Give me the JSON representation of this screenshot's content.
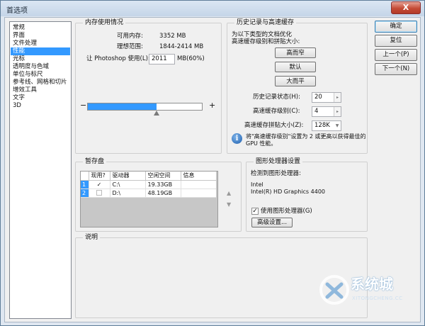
{
  "window": {
    "title": "首选项",
    "close_label": "X"
  },
  "categories": [
    {
      "label": "常规",
      "selected": false
    },
    {
      "label": "界面",
      "selected": false
    },
    {
      "label": "文件处理",
      "selected": false
    },
    {
      "label": "性能",
      "selected": true
    },
    {
      "label": "光标",
      "selected": false
    },
    {
      "label": "透明度与色域",
      "selected": false
    },
    {
      "label": "单位与标尺",
      "selected": false
    },
    {
      "label": "参考线、网格和切片",
      "selected": false
    },
    {
      "label": "增效工具",
      "selected": false
    },
    {
      "label": "文字",
      "selected": false
    },
    {
      "label": "3D",
      "selected": false
    }
  ],
  "memory": {
    "title": "内存使用情况",
    "available_label": "可用内存:",
    "available_value": "3352 MB",
    "ideal_label": "理想范围:",
    "ideal_value": "1844-2414 MB",
    "let_label": "让 Photoshop 使用(L):",
    "use_value": "2011",
    "unit_percent": "MB(60%)",
    "slider_minus": "−",
    "slider_plus": "+",
    "slider_fraction": 0.6,
    "fill_color": "#3399ff"
  },
  "history": {
    "title": "历史记录与高速缓存",
    "desc": "为以下类型的文档优化\n高速缓存级别和拼贴大小:",
    "btn_tall_thin": "高而窄",
    "btn_default": "默认",
    "btn_big_flat": "大而平",
    "states_label": "历史记录状态(H):",
    "states_value": "20",
    "cache_levels_label": "高速缓存级别(C):",
    "cache_levels_value": "4",
    "tile_size_label": "高速缓存拼贴大小(Z):",
    "tile_size_value": "128K",
    "info_text": "将\"高速缓存级别\"设置为 2 或更高以获得最佳的\nGPU 性能。"
  },
  "scratch": {
    "title": "暂存盘",
    "headers": {
      "active": "现用?",
      "drive": "驱动器",
      "free": "空闲空间",
      "info": "信息"
    },
    "rows": [
      {
        "num": "1",
        "checked": true,
        "check_mark": "✓",
        "drive": "C:\\",
        "free": "19.33GB",
        "info": ""
      },
      {
        "num": "2",
        "checked": false,
        "check_mark": "",
        "drive": "D:\\",
        "free": "48.19GB",
        "info": ""
      }
    ],
    "arrow_up": "▲",
    "arrow_down": "▼"
  },
  "gpu": {
    "title": "图形处理器设置",
    "detected_label": "检测到图形处理器:",
    "vendor": "Intel",
    "model": "Intel(R) HD Graphics 4400",
    "use_gpu_label": "使用图形处理器(G)",
    "use_gpu_checked": true,
    "check_mark": "✓",
    "advanced_button": "高级设置..."
  },
  "description": {
    "title": "说明"
  },
  "actions": {
    "ok": "确定",
    "reset": "复位",
    "prev": "上一个(P)",
    "next": "下一个(N)"
  },
  "watermark": {
    "brand": "系统城",
    "url": "XITONGCHENG.CC"
  }
}
